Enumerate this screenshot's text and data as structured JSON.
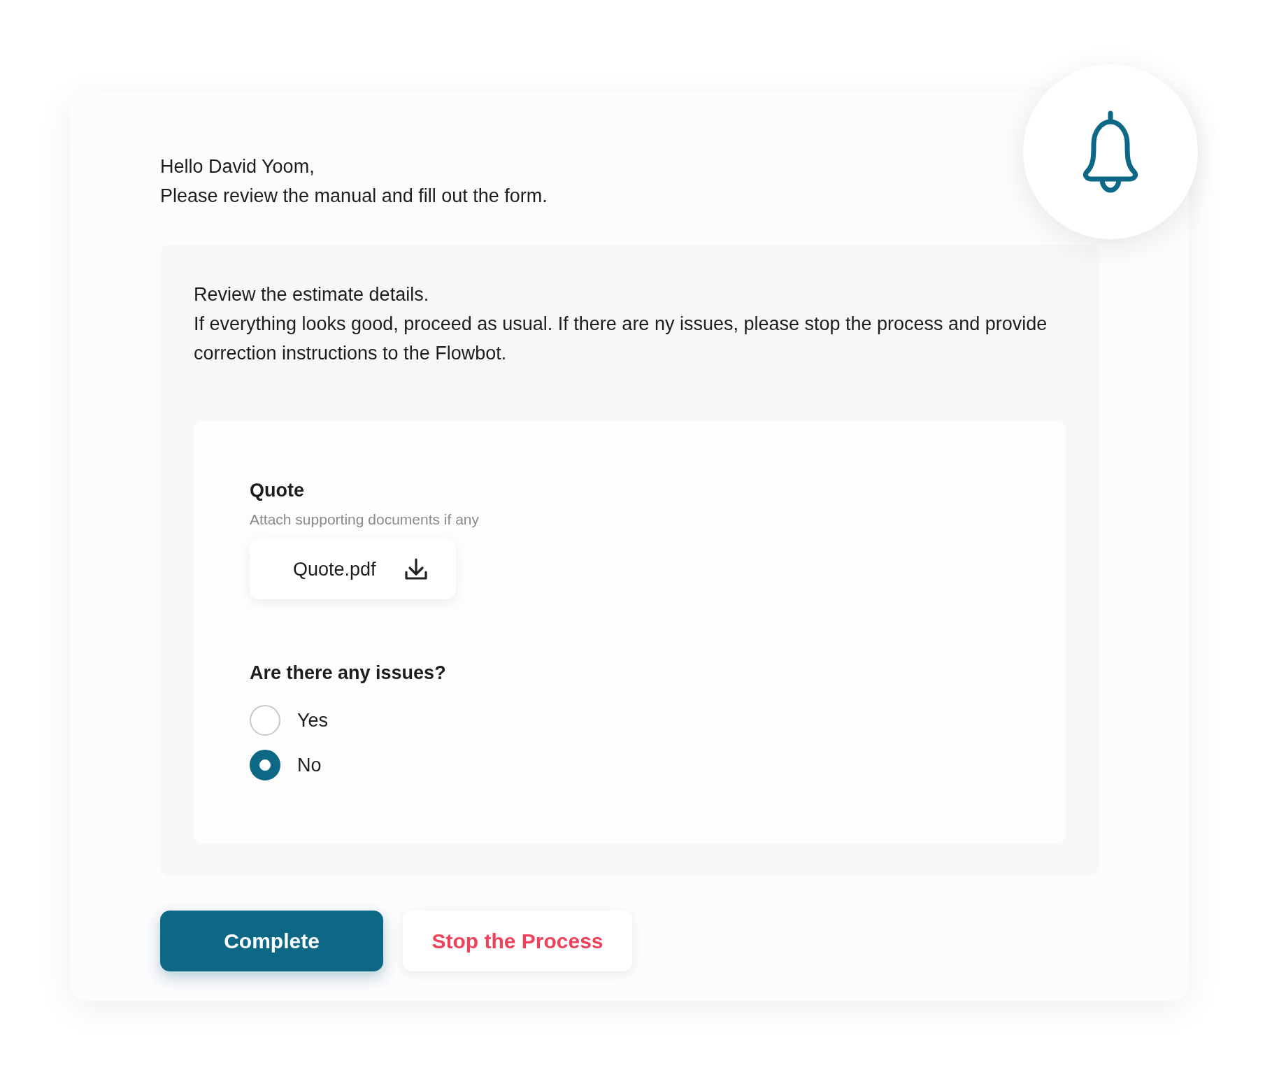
{
  "greeting": [
    "Hello David Yoom,",
    "Please review the manual and fill out the form."
  ],
  "instructions": [
    "Review the estimate details.",
    "If everything looks good, proceed as usual. If there are ny issues, please stop the process and provide correction instructions to the Flowbot."
  ],
  "attachment": {
    "label": "Quote",
    "hint": "Attach supporting documents if any",
    "file": "Quote.pdf"
  },
  "question": {
    "label": "Are there any issues?",
    "options": [
      {
        "label": "Yes",
        "selected": false
      },
      {
        "label": "No",
        "selected": true
      }
    ]
  },
  "buttons": [
    {
      "label": "Complete",
      "kind": "primary"
    },
    {
      "label": "Stop the Process",
      "kind": "danger"
    }
  ]
}
